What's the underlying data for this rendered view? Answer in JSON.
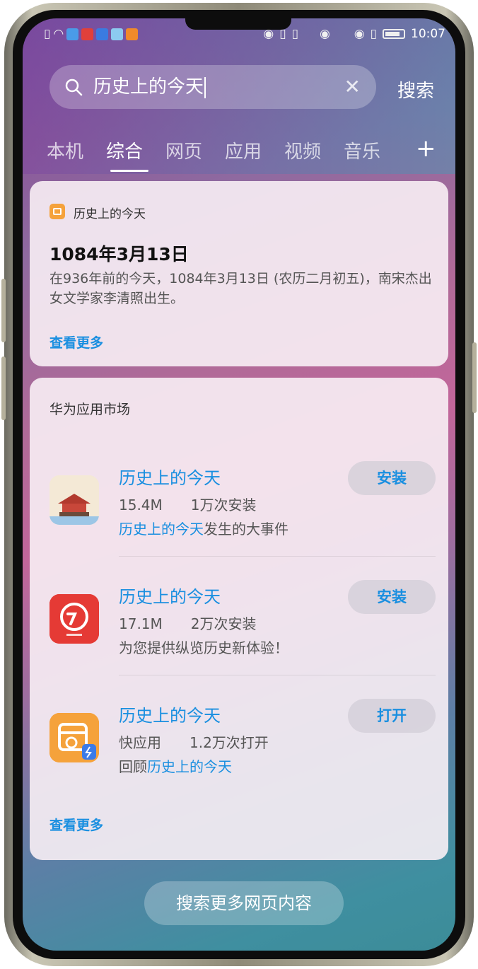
{
  "status_bar": {
    "time": "10:07",
    "left_icons": [
      "sim-card-icon",
      "wifi-icon",
      "browser-icon",
      "red-app-icon",
      "blue-app-icon",
      "mail-icon",
      "shield-icon"
    ],
    "right_icons": [
      "eye-comfort-icon",
      "vibrate-icon",
      "vibrate-icon",
      "eye-comfort-icon",
      "eye-comfort-icon",
      "vibrate-icon",
      "battery-icon"
    ]
  },
  "search": {
    "query": "历史上的今天",
    "button_label": "搜索"
  },
  "tabs": [
    {
      "label": "本机"
    },
    {
      "label": "综合"
    },
    {
      "label": "网页"
    },
    {
      "label": "应用"
    },
    {
      "label": "视频"
    },
    {
      "label": "音乐"
    }
  ],
  "tabs_add": "+",
  "history_card": {
    "source": "历史上的今天",
    "date": "1084年3月13日",
    "description": "在936年前的今天，1084年3月13日 (农历二月初五)，南宋杰出女文学家李清照出生。",
    "more": "查看更多"
  },
  "app_market": {
    "title": "华为应用市场",
    "apps": [
      {
        "name": "历史上的今天",
        "size": "15.4M",
        "downloads": "1万次安装",
        "desc_highlight": "历史上的今天",
        "desc_rest": "发生的大事件",
        "button": "安装"
      },
      {
        "name": "历史上的今天",
        "size": "17.1M",
        "downloads": "2万次安装",
        "desc_highlight": "",
        "desc_rest": "为您提供纵览历史新体验！",
        "button": "安装"
      },
      {
        "name": "历史上的今天",
        "size": "快应用",
        "downloads": "1.2万次打开",
        "desc_prefix": "回顾",
        "desc_highlight": "历史上的今天",
        "button": "打开"
      }
    ],
    "more": "查看更多"
  },
  "bottom_button": "搜索更多网页内容",
  "colors": {
    "accent": "#1a8fe0",
    "card_bg": "#f8f0f5"
  }
}
